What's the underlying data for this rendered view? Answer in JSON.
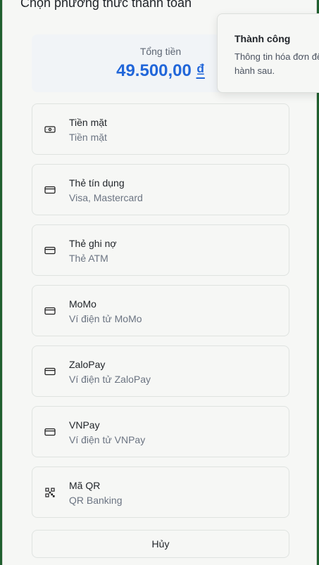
{
  "modal": {
    "title": "Chọn phương thức thanh toán",
    "total_label": "Tổng tiền",
    "total_amount": "49.500,00",
    "currency": "₫",
    "cancel_label": "Hủy"
  },
  "methods": [
    {
      "name": "Tiền mặt",
      "sub": "Tiền mặt",
      "icon": "cash-icon"
    },
    {
      "name": "Thẻ tín dụng",
      "sub": "Visa, Mastercard",
      "icon": "credit-card-icon"
    },
    {
      "name": "Thẻ ghi nợ",
      "sub": "Thẻ ATM",
      "icon": "credit-card-icon"
    },
    {
      "name": "MoMo",
      "sub": "Ví điện tử MoMo",
      "icon": "credit-card-icon"
    },
    {
      "name": "ZaloPay",
      "sub": "Ví điện tử ZaloPay",
      "icon": "credit-card-icon"
    },
    {
      "name": "VNPay",
      "sub": "Ví điện tử VNPay",
      "icon": "credit-card-icon"
    },
    {
      "name": "Mã QR",
      "sub": "QR Banking",
      "icon": "qr-code-icon"
    }
  ],
  "toast": {
    "title": "Thành công",
    "message": "Thông tin hóa đơn để phát hành sau."
  },
  "colors": {
    "accent": "#2166d9",
    "background": "#f6f7f5",
    "backdrop": "#1f5f2e"
  }
}
